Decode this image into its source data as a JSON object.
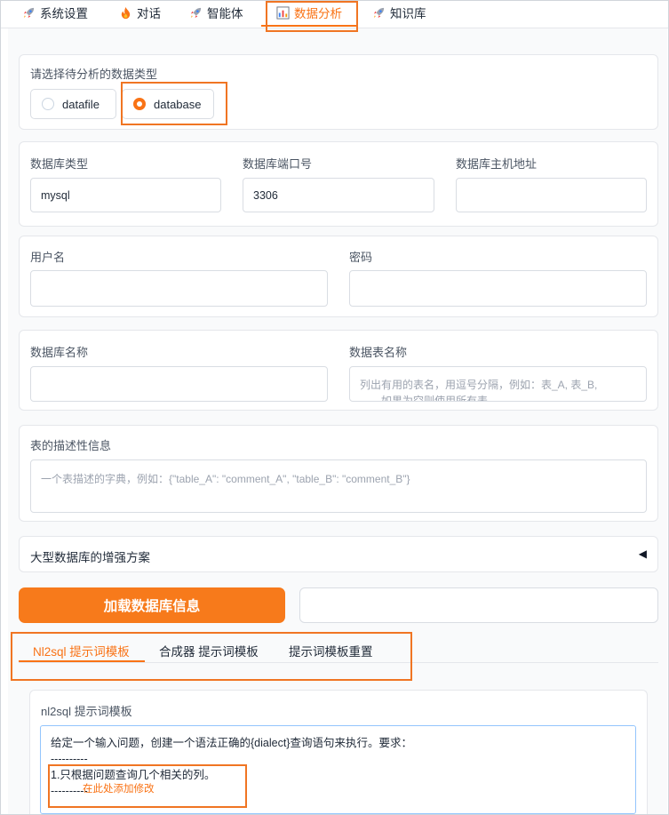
{
  "nav": {
    "tabs": [
      {
        "label": "系统设置",
        "icon": "rocket-icon"
      },
      {
        "label": "对话",
        "icon": "fire-icon"
      },
      {
        "label": "智能体",
        "icon": "rocket-icon"
      },
      {
        "label": "数据分析",
        "icon": "bar-chart-icon",
        "active": true
      },
      {
        "label": "知识库",
        "icon": "rocket-icon"
      }
    ]
  },
  "data_type": {
    "label": "请选择待分析的数据类型",
    "options": [
      {
        "label": "datafile",
        "selected": false
      },
      {
        "label": "database",
        "selected": true
      }
    ]
  },
  "db_conn": {
    "type_label": "数据库类型",
    "type_value": "mysql",
    "port_label": "数据库端口号",
    "port_value": "3306",
    "host_label": "数据库主机地址",
    "host_value": ""
  },
  "auth": {
    "user_label": "用户名",
    "user_value": "",
    "pass_label": "密码",
    "pass_value": ""
  },
  "db_names": {
    "db_label": "数据库名称",
    "db_value": "",
    "table_label": "数据表名称",
    "table_placeholder_line1": "列出有用的表名，用逗号分隔，例如：表_A, 表_B,",
    "table_placeholder_line2": "如果为空则使用所有表"
  },
  "table_desc": {
    "label": "表的描述性信息",
    "placeholder": "一个表描述的字典，例如：{\"table_A\": \"comment_A\", \"table_B\": \"comment_B\"}"
  },
  "accordion": {
    "label": "大型数据库的增强方案",
    "arrow": "◀"
  },
  "load_button": "加载数据库信息",
  "prompt_tabs": [
    {
      "label": "Nl2sql 提示词模板",
      "active": true
    },
    {
      "label": "合成器 提示词模板",
      "active": false
    },
    {
      "label": "提示词模板重置",
      "active": false
    }
  ],
  "template": {
    "label": "nl2sql 提示词模板",
    "lines": [
      "给定一个输入问题，创建一个语法正确的{dialect}查询语句来执行。要求：",
      "----------",
      "1.只根据问题查询几个相关的列。",
      "----------"
    ],
    "note": "在此处添加修改"
  },
  "colors": {
    "accent": "#f97316",
    "annotation": "#f07523"
  }
}
